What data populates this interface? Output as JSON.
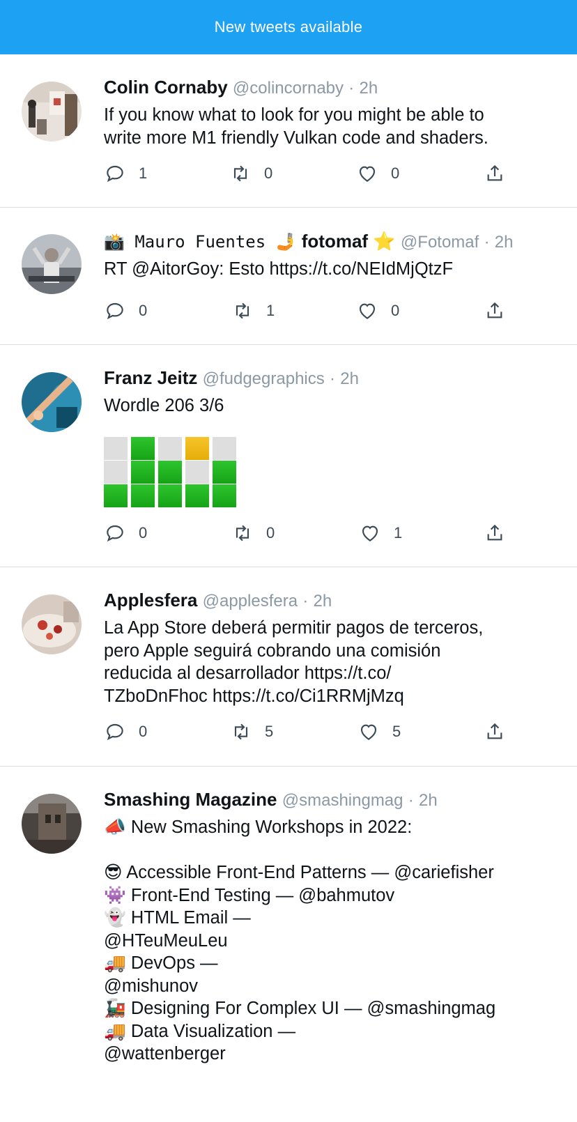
{
  "banner": {
    "label": "New tweets available"
  },
  "tweets": [
    {
      "name": "Colin Cornaby",
      "handle": "@colincornaby",
      "dot": "·",
      "time": "2h",
      "text": "If you know what to look for you might be able to\nwrite more M1 friendly Vulkan code and shaders.",
      "replies": "1",
      "retweets": "0",
      "likes": "0"
    },
    {
      "name_prefix": "📸 𝙼𝚊𝚞𝚛𝚘 𝙵𝚞𝚎𝚗𝚝𝚎𝚜 🤳",
      "name": "fotomaf",
      "name_suffix": "⭐",
      "handle": "@Fotomaf",
      "dot": "·",
      "time": "2h",
      "text": "RT @AitorGoy: Esto https://t.co/NEIdMjQtzF",
      "replies": "0",
      "retweets": "1",
      "likes": "0"
    },
    {
      "name": "Franz Jeitz",
      "handle": "@fudgegraphics",
      "dot": "·",
      "time": "2h",
      "text": "Wordle 206 3/6",
      "wordle": [
        [
          "gray",
          "green",
          "gray",
          "yellow",
          "gray"
        ],
        [
          "gray",
          "green",
          "green",
          "gray",
          "green"
        ],
        [
          "green",
          "green",
          "green",
          "green",
          "green"
        ]
      ],
      "replies": "0",
      "retweets": "0",
      "likes": "1"
    },
    {
      "name": "Applesfera",
      "handle": "@applesfera",
      "dot": "·",
      "time": "2h",
      "text": "La App Store deberá permitir pagos de terceros,\npero Apple seguirá cobrando una comisión\nreducida al desarrollador https://t.co/\nTZboDnFhoc https://t.co/Ci1RRMjMzq",
      "replies": "0",
      "retweets": "5",
      "likes": "5"
    },
    {
      "name": "Smashing Magazine",
      "handle": "@smashingmag",
      "dot": "·",
      "time": "2h",
      "text": "📣 New Smashing Workshops in 2022:\n\n😎 Accessible Front-End Patterns — @cariefisher\n👾 Front-End Testing — @bahmutov\n👻 HTML Email —\n@HTeuMeuLeu\n🚚 DevOps —\n@mishunov\n🚂 Designing For Complex UI — @smashingmag\n🚚 Data Visualization —\n@wattenberger"
    }
  ]
}
